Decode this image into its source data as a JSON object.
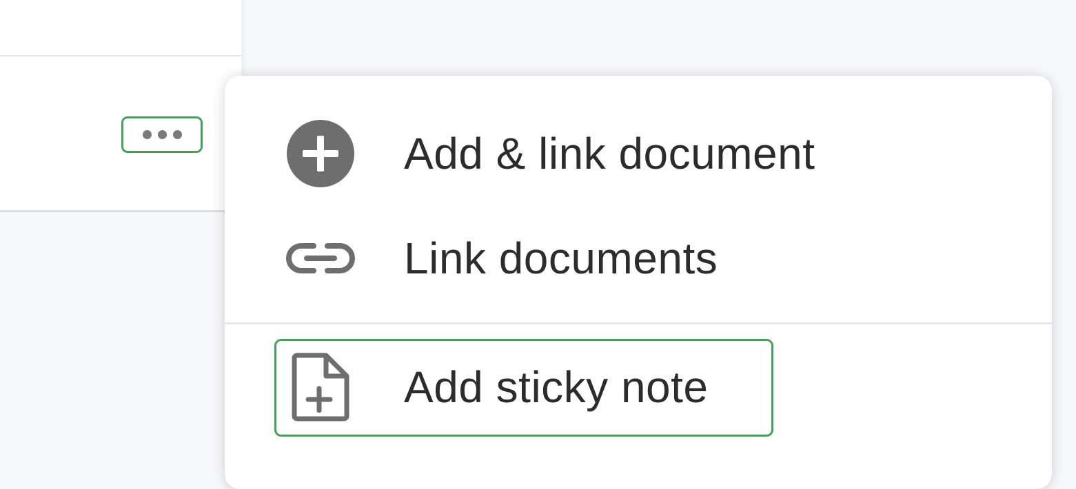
{
  "more_button": {
    "icon": "ellipsis-icon"
  },
  "menu": {
    "items": [
      {
        "label": "Add & link document",
        "icon": "plus-circle-icon"
      },
      {
        "label": "Link documents",
        "icon": "link-icon"
      },
      {
        "label": "Add sticky note",
        "icon": "file-plus-icon"
      }
    ]
  },
  "colors": {
    "highlight": "#43a15a",
    "icon": "#6e6e6e",
    "text": "#2c2c2c"
  }
}
